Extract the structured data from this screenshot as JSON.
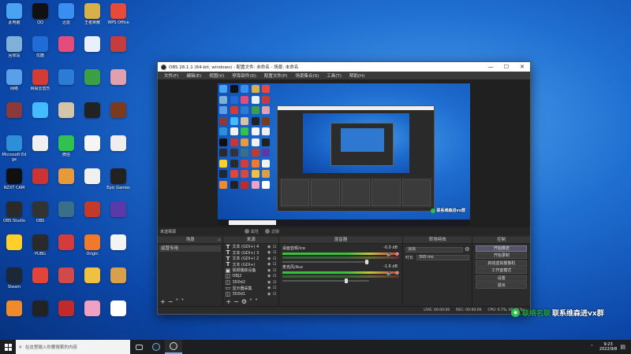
{
  "desktop": {
    "icons": [
      {
        "label": "此电脑",
        "color": "#4aa3f0"
      },
      {
        "label": "QQ",
        "color": "#111111"
      },
      {
        "label": "迅雷",
        "color": "#3a8ef0"
      },
      {
        "label": "王者荣耀",
        "color": "#d8b04a"
      },
      {
        "label": "WPS Office",
        "color": "#e84a3a"
      },
      {
        "label": "回收站",
        "color": "#7fb0d8"
      },
      {
        "label": "优酷",
        "color": "#1f6cd6"
      },
      {
        "label": "",
        "color": "#e34c7d"
      },
      {
        "label": "",
        "color": "#e8f0fb"
      },
      {
        "label": "",
        "color": "#c43c3c"
      },
      {
        "label": "网络",
        "color": "#5aa0e8"
      },
      {
        "label": "网易云音乐",
        "color": "#d43c33"
      },
      {
        "label": "",
        "color": "#2c7bd5"
      },
      {
        "label": "",
        "color": "#3aa043"
      },
      {
        "label": "",
        "color": "#e0a0b0"
      },
      {
        "label": "",
        "color": "#8a3a3a"
      },
      {
        "label": "",
        "color": "#44bbff"
      },
      {
        "label": "",
        "color": "#d4c4a8"
      },
      {
        "label": "",
        "color": "#222222"
      },
      {
        "label": "",
        "color": "#7a3a1e"
      },
      {
        "label": "Microsoft Edge",
        "color": "#2d8fd8"
      },
      {
        "label": "",
        "color": "#f0f0f0"
      },
      {
        "label": "微信",
        "color": "#30c150"
      },
      {
        "label": "",
        "color": "#f5f5f5"
      },
      {
        "label": "",
        "color": "#eeeeee"
      },
      {
        "label": "NZXT CAM",
        "color": "#101010"
      },
      {
        "label": "",
        "color": "#cc3333"
      },
      {
        "label": "",
        "color": "#e79a3a"
      },
      {
        "label": "",
        "color": "#f0f0f0"
      },
      {
        "label": "Epic Games",
        "color": "#222222"
      },
      {
        "label": "OBS Studio",
        "color": "#2a2a2a"
      },
      {
        "label": "OBS",
        "color": "#333333"
      },
      {
        "label": "",
        "color": "#3a6f8a"
      },
      {
        "label": "",
        "color": "#c23a2a"
      },
      {
        "label": "",
        "color": "#5a3aa8"
      },
      {
        "label": "",
        "color": "#ffcf2a"
      },
      {
        "label": "PUBG",
        "color": "#2a2a2a"
      },
      {
        "label": "",
        "color": "#d43c3c"
      },
      {
        "label": "Origin",
        "color": "#f07a2a"
      },
      {
        "label": "",
        "color": "#f3f3f3"
      },
      {
        "label": "Steam",
        "color": "#1b2838"
      },
      {
        "label": "",
        "color": "#e2443a"
      },
      {
        "label": "",
        "color": "#d04a4a"
      },
      {
        "label": "",
        "color": "#f0c040"
      },
      {
        "label": "",
        "color": "#d8a04a"
      },
      {
        "label": "",
        "color": "#f08a2a"
      },
      {
        "label": "",
        "color": "#222222"
      },
      {
        "label": "",
        "color": "#c02a2a"
      },
      {
        "label": "",
        "color": "#f0a0c0"
      },
      {
        "label": "",
        "color": "#ffffff"
      }
    ],
    "watermark_green": "联络名联",
    "watermark_white": "联系维森进vx群"
  },
  "obs": {
    "title": "OBS 28.1.1 (64-bit, windows) - 配置文件: 未命名 - 场景: 未命名",
    "menu": [
      "文件(F)",
      "编辑(E)",
      "视图(V)",
      "停靠部件(D)",
      "配置文件(P)",
      "场景集合(S)",
      "工具(T)",
      "帮助(H)"
    ],
    "status_row": {
      "scene_label": "未选择源",
      "props": "属性",
      "filters": "滤镜"
    },
    "preview_watermark": "联系维森进vx群",
    "docks": {
      "scenes": {
        "title": "场景",
        "items": [
          "运营专用"
        ]
      },
      "sources": {
        "title": "来源",
        "items": [
          {
            "icon": "T",
            "name": "文本 (GDI+) 4"
          },
          {
            "icon": "T",
            "name": "文本 (GDI+) 3"
          },
          {
            "icon": "T",
            "name": "文本 (GDI+) 2"
          },
          {
            "icon": "T",
            "name": "文本 (GDI+)"
          },
          {
            "icon": "▣",
            "name": "视频捕获设备"
          },
          {
            "icon": "◫",
            "name": "OBJ2"
          },
          {
            "icon": "◫",
            "name": "3D0d2"
          },
          {
            "icon": "▭",
            "name": "显示器采集"
          },
          {
            "icon": "◫",
            "name": "3D0d1"
          }
        ]
      },
      "mixer": {
        "title": "混音器",
        "channels": [
          {
            "name": "桌面音频/ice",
            "db": "-0.0 dB",
            "level": 0.95
          },
          {
            "name": "麦克风/Aux",
            "db": "-1.6 dB",
            "level": 0.72
          }
        ]
      },
      "transitions": {
        "title": "转场特效",
        "type": "淡出",
        "duration_label": "时长",
        "duration": "300 ms"
      },
      "controls": {
        "title": "控制",
        "buttons": [
          "开始推流",
          "开始录制",
          "启动虚拟摄像机",
          "工作室模式",
          "设置",
          "退出"
        ]
      }
    },
    "statusbar": {
      "live": "LIVE: 00:00:00",
      "rec": "REC: 00:00:00",
      "cpu": "CPU: 0.7%, 60.00 fps"
    }
  },
  "taskbar": {
    "search_placeholder": "在这里输入你要搜索的内容",
    "time": "9:23",
    "date": "2022/9/8"
  }
}
